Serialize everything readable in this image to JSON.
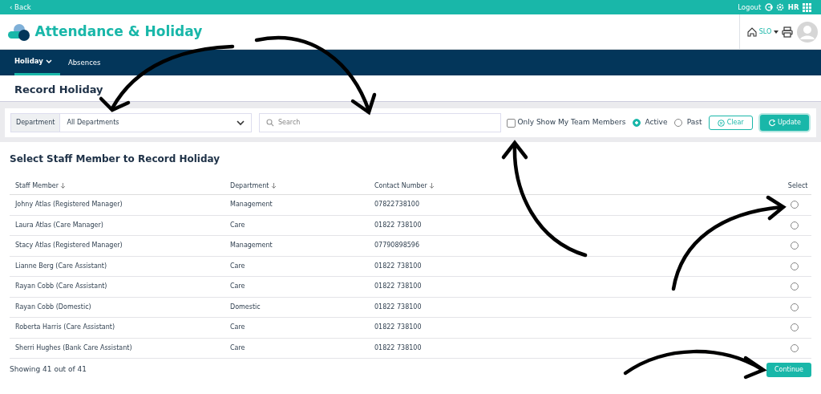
{
  "top_bar": {
    "back": "‹ Back",
    "logout": "Logout",
    "user_initials": "HR"
  },
  "header": {
    "app_title": "Attendance & Holiday",
    "site": "SLO"
  },
  "nav": [
    {
      "label": "Holiday",
      "selected": true,
      "dropdown": true
    },
    {
      "label": "Absences",
      "selected": false,
      "dropdown": false
    }
  ],
  "page_title": "Record Holiday",
  "filters": {
    "department_label": "Department",
    "department_value": "All Departments",
    "search_placeholder": "Search",
    "team_only": {
      "label": "Only Show My Team Members",
      "checked": false
    },
    "status": [
      {
        "label": "Active",
        "selected": true
      },
      {
        "label": "Past",
        "selected": false
      }
    ],
    "clear": "Clear",
    "update": "Update"
  },
  "table": {
    "title": "Select Staff Member to Record Holiday",
    "columns": [
      {
        "label": "Staff Member",
        "sortable": true
      },
      {
        "label": "Department",
        "sortable": true
      },
      {
        "label": "Contact Number",
        "sortable": true
      },
      {
        "label": "Select",
        "sortable": false
      }
    ],
    "rows": [
      {
        "name": "Johny Atlas (Registered Manager)",
        "department": "Management",
        "contact": "07822738100",
        "selected": false
      },
      {
        "name": "Laura Atlas (Care Manager)",
        "department": "Care",
        "contact": "01822 738100",
        "selected": false
      },
      {
        "name": "Stacy Atlas (Registered Manager)",
        "department": "Management",
        "contact": "07790898596",
        "selected": false
      },
      {
        "name": "Lianne Berg (Care Assistant)",
        "department": "Care",
        "contact": "01822 738100",
        "selected": false
      },
      {
        "name": "Rayan Cobb (Care Assistant)",
        "department": "Care",
        "contact": "01822 738100",
        "selected": false
      },
      {
        "name": "Rayan Cobb (Domestic)",
        "department": "Domestic",
        "contact": "01822 738100",
        "selected": false
      },
      {
        "name": "Roberta Harris (Care Assistant)",
        "department": "Care",
        "contact": "01822 738100",
        "selected": false
      },
      {
        "name": "Sherri Hughes (Bank Care Assistant)",
        "department": "Care",
        "contact": "01822 738100",
        "selected": false
      }
    ],
    "footer": "Showing 41 out of 41",
    "continue": "Continue"
  }
}
